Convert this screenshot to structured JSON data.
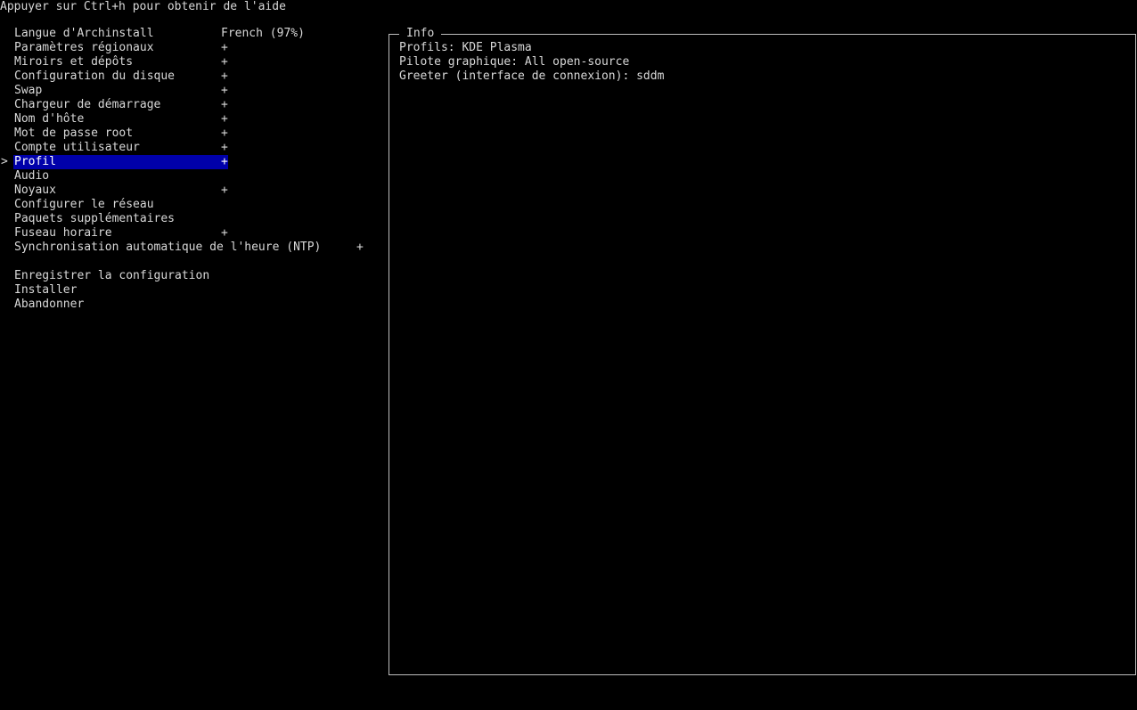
{
  "help_text": "Appuyer sur Ctrl+h pour obtenir de l'aide",
  "cursor": ">",
  "menu": {
    "items": [
      {
        "label": "Langue d'Archinstall",
        "value": "French (97%)"
      },
      {
        "label": "Paramètres régionaux",
        "value": "+"
      },
      {
        "label": "Miroirs et dépôts",
        "value": "+"
      },
      {
        "label": "Configuration du disque",
        "value": "+"
      },
      {
        "label": "Swap",
        "value": "+"
      },
      {
        "label": "Chargeur de démarrage",
        "value": "+"
      },
      {
        "label": "Nom d'hôte",
        "value": "+"
      },
      {
        "label": "Mot de passe root",
        "value": "+"
      },
      {
        "label": "Compte utilisateur",
        "value": "+"
      },
      {
        "label": "Profil",
        "value": "+",
        "selected": true
      },
      {
        "label": "Audio",
        "value": ""
      },
      {
        "label": "Noyaux",
        "value": "+"
      },
      {
        "label": "Configurer le réseau",
        "value": ""
      },
      {
        "label": "Paquets supplémentaires",
        "value": ""
      },
      {
        "label": "Fuseau horaire",
        "value": "+"
      },
      {
        "label": "Synchronisation automatique de l'heure (NTP)",
        "value": "+"
      }
    ],
    "actions": [
      {
        "label": "Enregistrer la configuration"
      },
      {
        "label": "Installer"
      },
      {
        "label": "Abandonner"
      }
    ]
  },
  "info": {
    "title": "Info",
    "lines": [
      "Profils: KDE Plasma",
      "Pilote graphique: All open-source",
      "Greeter (interface de connexion): sddm"
    ]
  },
  "colors": {
    "background": "#000000",
    "foreground": "#d8d8d8",
    "selection_bg": "#0000aa",
    "frame_border": "#bdbdbd"
  }
}
